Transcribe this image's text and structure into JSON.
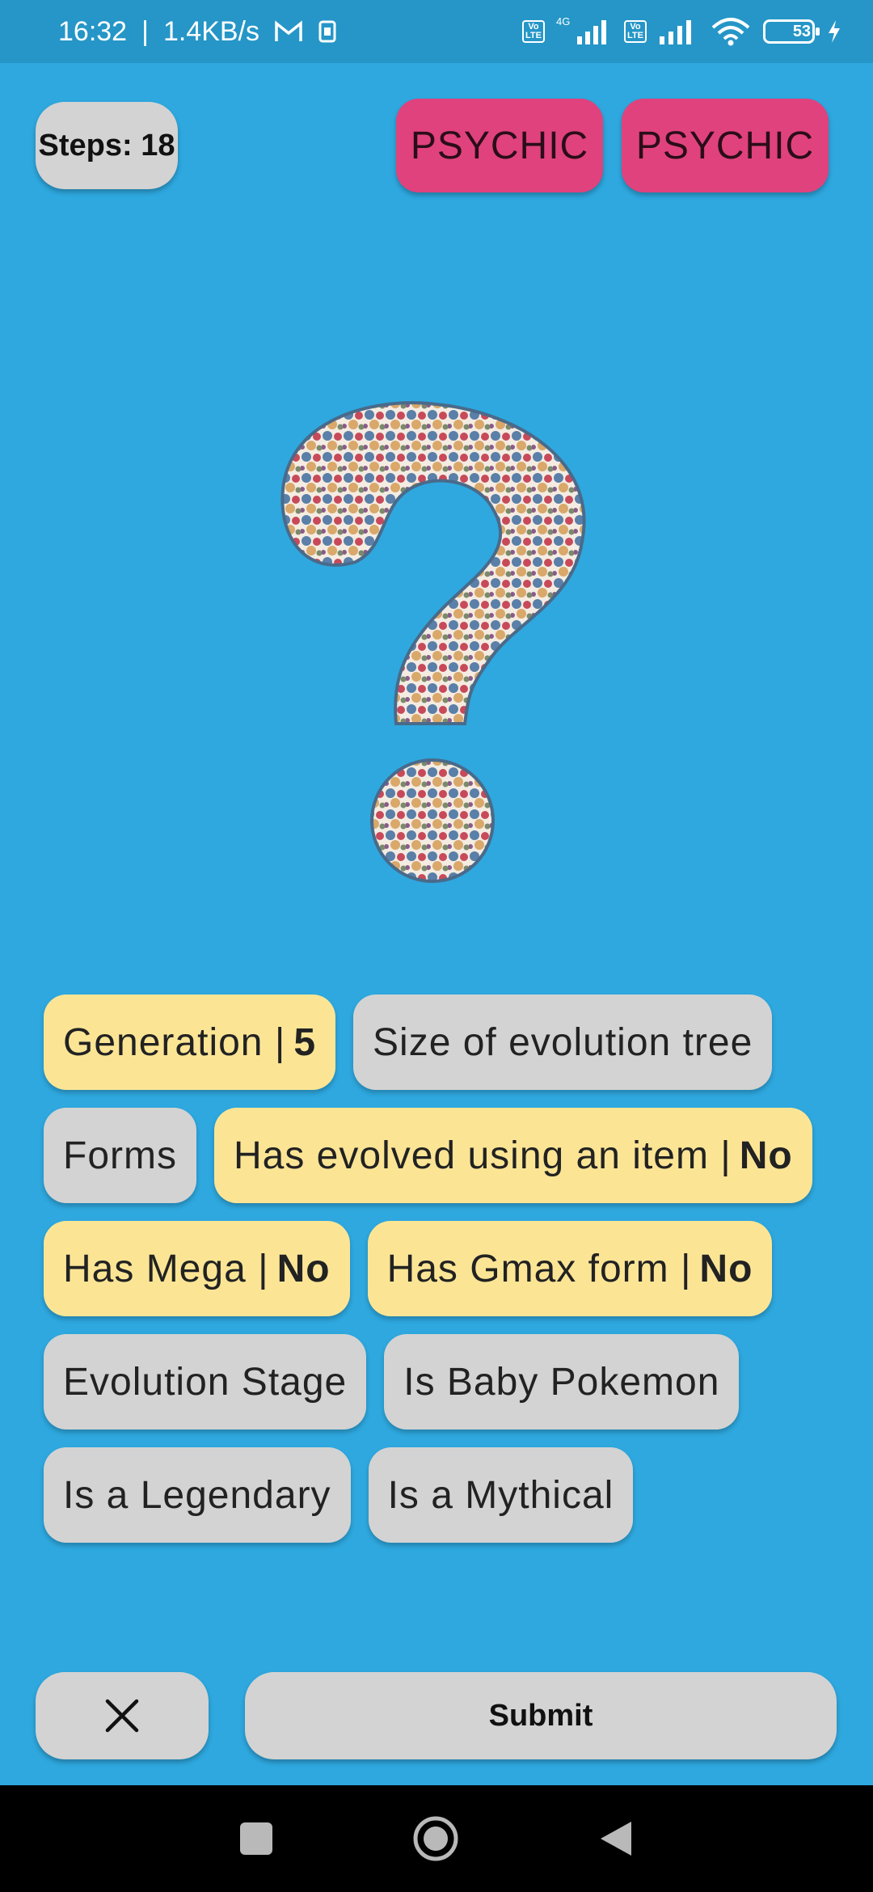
{
  "status_bar": {
    "time": "16:32",
    "network_speed": "1.4KB/s",
    "battery_level": "53",
    "icons": [
      "gmail-icon",
      "sim-icon",
      "volte-icon",
      "4g-icon",
      "signal-icon",
      "wifi-icon",
      "battery-icon",
      "charging-icon"
    ]
  },
  "header": {
    "steps_label": "Steps: 18",
    "types": [
      "PSYCHIC",
      "PSYCHIC"
    ]
  },
  "colors": {
    "background": "#2ea8df",
    "type_psychic": "#e0427d",
    "chip_answered": "#fbe595",
    "chip_unanswered": "#d3d3d3"
  },
  "hidden_pokemon": {
    "icon": "question-mark-icon"
  },
  "questions": [
    {
      "label": "Generation",
      "answer": "5",
      "answered": true
    },
    {
      "label": "Size of evolution tree",
      "answer": "",
      "answered": false
    },
    {
      "label": "Forms",
      "answer": "",
      "answered": false
    },
    {
      "label": "Has evolved using an item",
      "answer": "No",
      "answered": true
    },
    {
      "label": "Has Mega",
      "answer": "No",
      "answered": true
    },
    {
      "label": "Has Gmax form",
      "answer": "No",
      "answered": true
    },
    {
      "label": "Evolution Stage",
      "answer": "",
      "answered": false
    },
    {
      "label": "Is Baby Pokemon",
      "answer": "",
      "answered": false
    },
    {
      "label": "Is a Legendary",
      "answer": "",
      "answered": false
    },
    {
      "label": "Is a Mythical",
      "answer": "",
      "answered": false
    }
  ],
  "footer": {
    "close_icon": "close-icon",
    "submit_label": "Submit"
  }
}
